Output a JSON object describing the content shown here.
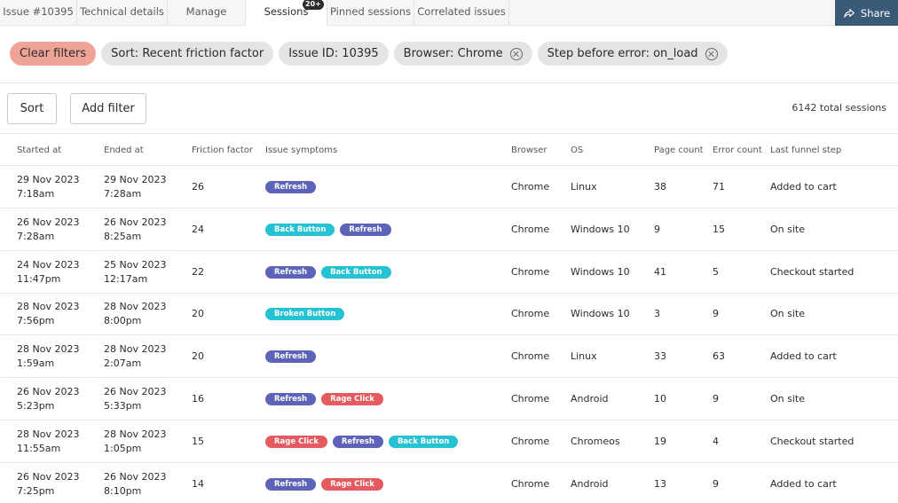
{
  "tabs": [
    {
      "label": "Issue #10395",
      "active": false
    },
    {
      "label": "Technical details",
      "active": false
    },
    {
      "label": "Manage",
      "active": false
    },
    {
      "label": "Sessions",
      "active": true,
      "badge": "20+"
    },
    {
      "label": "Pinned sessions",
      "active": false
    },
    {
      "label": "Correlated issues",
      "active": false
    }
  ],
  "share": {
    "label": "Share",
    "icon": "share-icon",
    "color": "#3a5a78"
  },
  "filters": {
    "clear_label": "Clear filters",
    "chips": [
      {
        "label": "Sort: Recent friction factor",
        "removable": false
      },
      {
        "label": "Issue ID: 10395",
        "removable": false
      },
      {
        "label": "Browser: Chrome",
        "removable": true
      },
      {
        "label": "Step before error: on_load",
        "removable": true
      }
    ]
  },
  "actions": {
    "sort_label": "Sort",
    "add_filter_label": "Add filter",
    "total_sessions": "6142 total sessions"
  },
  "table": {
    "columns": [
      "Started at",
      "Ended at",
      "Friction factor",
      "Issue symptoms",
      "Browser",
      "OS",
      "Page count",
      "Error count",
      "Last funnel step"
    ],
    "rows": [
      {
        "start_date": "29 Nov 2023",
        "start_time": "7:18am",
        "end_date": "29 Nov 2023",
        "end_time": "7:28am",
        "friction": "26",
        "symptoms": [
          "Refresh"
        ],
        "browser": "Chrome",
        "os": "Linux",
        "pages": "38",
        "errors": "71",
        "step": "Added to cart"
      },
      {
        "start_date": "26 Nov 2023",
        "start_time": "7:28am",
        "end_date": "26 Nov 2023",
        "end_time": "8:25am",
        "friction": "24",
        "symptoms": [
          "Back Button",
          "Refresh"
        ],
        "browser": "Chrome",
        "os": "Windows 10",
        "pages": "9",
        "errors": "15",
        "step": "On site"
      },
      {
        "start_date": "24 Nov 2023",
        "start_time": "11:47pm",
        "end_date": "25 Nov 2023",
        "end_time": "12:17am",
        "friction": "22",
        "symptoms": [
          "Refresh",
          "Back Button"
        ],
        "browser": "Chrome",
        "os": "Windows 10",
        "pages": "41",
        "errors": "5",
        "step": "Checkout started"
      },
      {
        "start_date": "28 Nov 2023",
        "start_time": "7:56pm",
        "end_date": "28 Nov 2023",
        "end_time": "8:00pm",
        "friction": "20",
        "symptoms": [
          "Broken Button"
        ],
        "browser": "Chrome",
        "os": "Windows 10",
        "pages": "3",
        "errors": "9",
        "step": "On site"
      },
      {
        "start_date": "28 Nov 2023",
        "start_time": "1:59am",
        "end_date": "28 Nov 2023",
        "end_time": "2:07am",
        "friction": "20",
        "symptoms": [
          "Refresh"
        ],
        "browser": "Chrome",
        "os": "Linux",
        "pages": "33",
        "errors": "63",
        "step": "Added to cart"
      },
      {
        "start_date": "26 Nov 2023",
        "start_time": "5:23pm",
        "end_date": "26 Nov 2023",
        "end_time": "5:33pm",
        "friction": "16",
        "symptoms": [
          "Refresh",
          "Rage Click"
        ],
        "browser": "Chrome",
        "os": "Android",
        "pages": "10",
        "errors": "9",
        "step": "On site"
      },
      {
        "start_date": "28 Nov 2023",
        "start_time": "11:55am",
        "end_date": "28 Nov 2023",
        "end_time": "1:05pm",
        "friction": "15",
        "symptoms": [
          "Rage Click",
          "Refresh",
          "Back Button"
        ],
        "browser": "Chrome",
        "os": "Chromeos",
        "pages": "19",
        "errors": "4",
        "step": "Checkout started"
      },
      {
        "start_date": "26 Nov 2023",
        "start_time": "7:25pm",
        "end_date": "26 Nov 2023",
        "end_time": "8:10pm",
        "friction": "14",
        "symptoms": [
          "Refresh",
          "Rage Click"
        ],
        "browser": "Chrome",
        "os": "Android",
        "pages": "13",
        "errors": "9",
        "step": "Added to cart"
      }
    ]
  },
  "symptom_colors": {
    "Refresh": "#5c63b8",
    "Back Button": "#25c2d3",
    "Broken Button": "#25c2d3",
    "Rage Click": "#e45a5f"
  }
}
